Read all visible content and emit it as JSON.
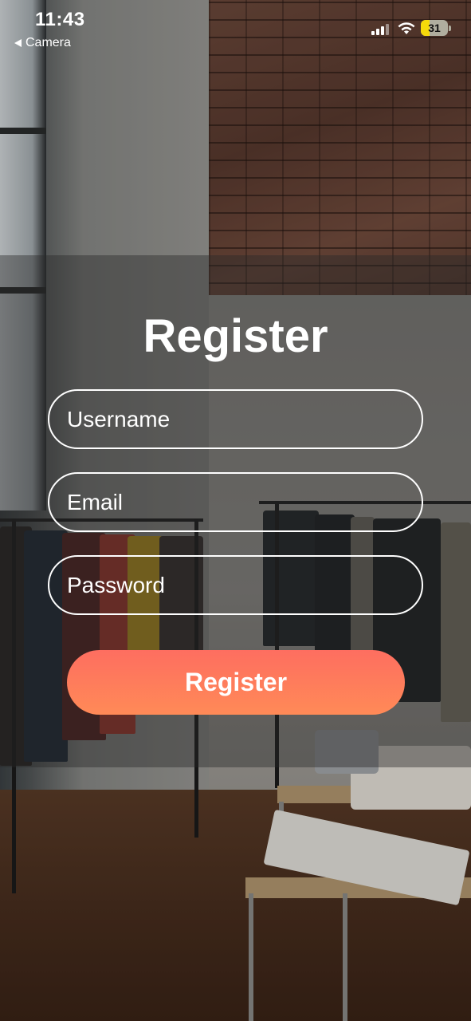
{
  "status_bar": {
    "time": "11:43",
    "back_app": "Camera",
    "battery_level": "31",
    "battery_percent": 31,
    "battery_color": "#f5d90a"
  },
  "icons": {
    "back": "back-triangle-icon",
    "signal": "cellular-signal-icon",
    "wifi": "wifi-icon",
    "battery": "battery-icon"
  },
  "form": {
    "title": "Register",
    "username_placeholder": "Username",
    "email_placeholder": "Email",
    "password_placeholder": "Password",
    "submit_label": "Register"
  },
  "colors": {
    "button_gradient_start": "#fe6e60",
    "button_gradient_end": "#ff8a57",
    "text": "#ffffff"
  }
}
